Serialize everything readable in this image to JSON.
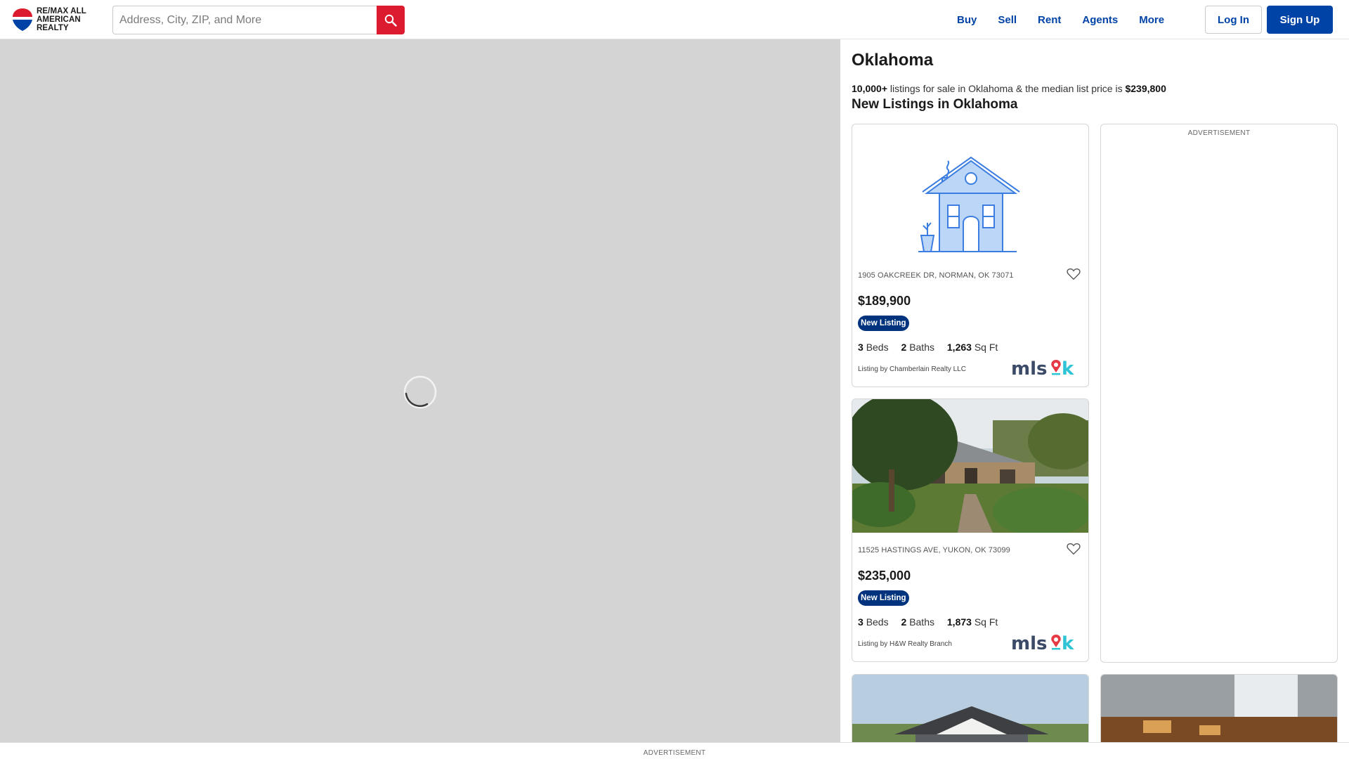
{
  "header": {
    "logo_text": "RE/MAX ALL AMERICAN REALTY",
    "search_placeholder": "Address, City, ZIP, and More",
    "nav": [
      "Buy",
      "Sell",
      "Rent",
      "Agents",
      "More"
    ],
    "login_label": "Log In",
    "signup_label": "Sign Up"
  },
  "colors": {
    "brand_blue": "#0043a7",
    "brand_red": "#dc1c2e",
    "badge_navy": "#00337e"
  },
  "region": {
    "title": "Oklahoma",
    "listing_count": "10,000+",
    "summary_middle": " listings for sale in Oklahoma & the median list price is ",
    "median_price": "$239,800",
    "section_title": "New Listings in Oklahoma"
  },
  "listings": [
    {
      "image": "house-illustration-icon",
      "address": "1905 OAKCREEK DR, NORMAN, OK 73071",
      "price": "$189,900",
      "badge": "New Listing",
      "beds": "3",
      "beds_label": "Beds",
      "baths": "2",
      "baths_label": "Baths",
      "sqft": "1,263",
      "sqft_label": "Sq Ft",
      "broker": "Listing by Chamberlain Realty LLC",
      "source_logo": "mlsok"
    },
    {
      "image": "house-photo",
      "address": "11525 HASTINGS AVE, YUKON, OK 73099",
      "price": "$235,000",
      "badge": "New Listing",
      "beds": "3",
      "beds_label": "Beds",
      "baths": "2",
      "baths_label": "Baths",
      "sqft": "1,873",
      "sqft_label": "Sq Ft",
      "broker": "Listing by H&W Realty Branch",
      "source_logo": "mlsok"
    }
  ],
  "ad_label": "ADVERTISEMENT",
  "bottom_ad_label": "ADVERTISEMENT"
}
